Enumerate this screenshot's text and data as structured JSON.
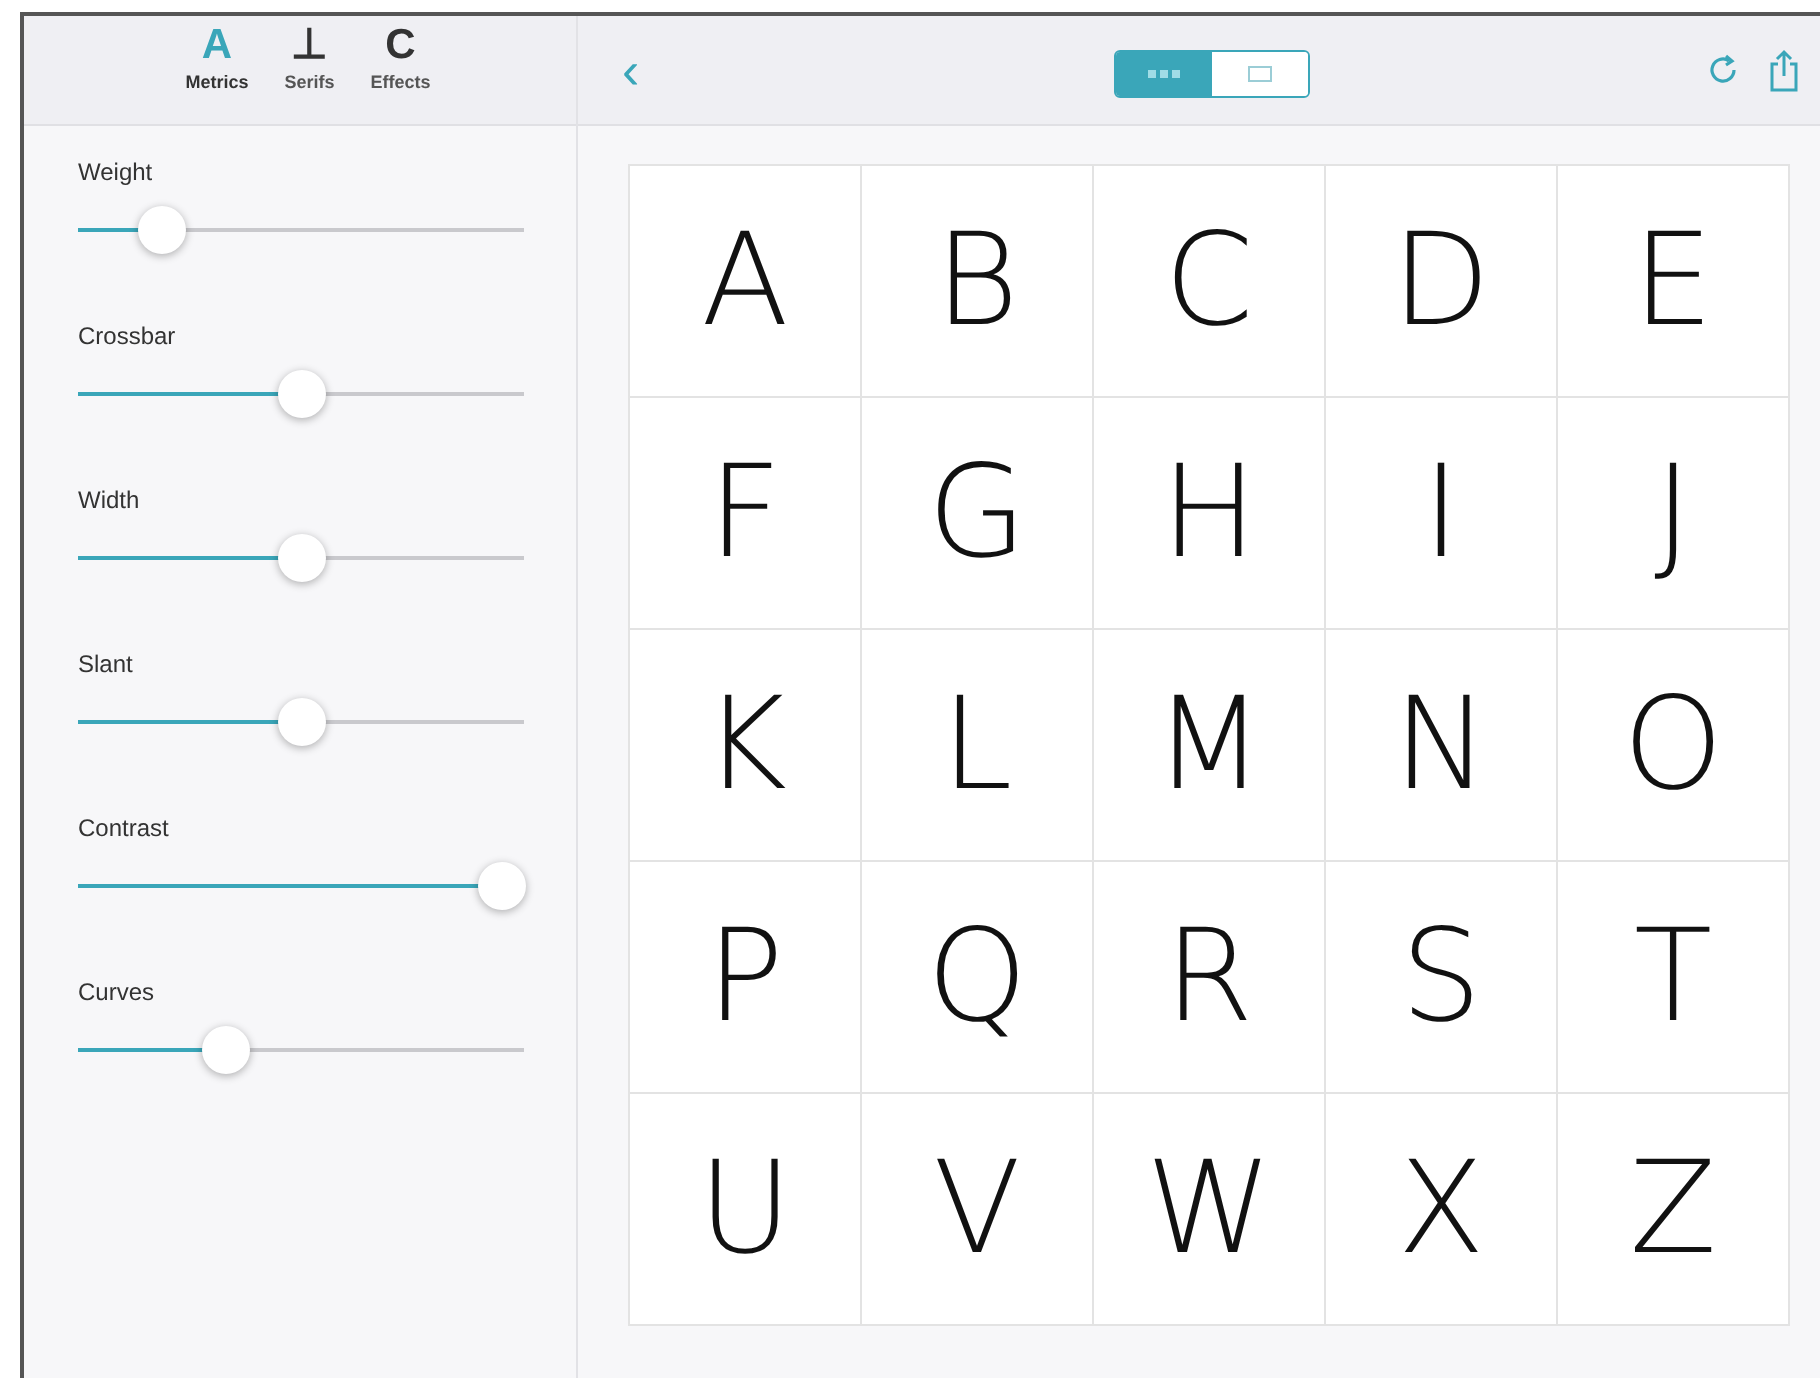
{
  "tabs": [
    {
      "glyph": "A",
      "label": "Metrics",
      "selected": true
    },
    {
      "glyph": "⊥",
      "label": "Serifs",
      "selected": false
    },
    {
      "glyph": "C",
      "label": "Effects",
      "selected": false
    }
  ],
  "sliders": [
    {
      "label": "Weight",
      "level": 0.19
    },
    {
      "label": "Crossbar",
      "level": 0.5
    },
    {
      "label": "Width",
      "level": 0.5
    },
    {
      "label": "Slant",
      "level": 0.5
    },
    {
      "label": "Contrast",
      "level": 0.95
    },
    {
      "label": "Curves",
      "level": 0.33
    }
  ],
  "toolbar": {
    "back": "‹",
    "view_modes": [
      {
        "kind": "grid",
        "selected": true
      },
      {
        "kind": "text",
        "selected": false
      }
    ]
  },
  "letters": [
    "A",
    "B",
    "C",
    "D",
    "E",
    "F",
    "G",
    "H",
    "I",
    "J",
    "K",
    "L",
    "M",
    "N",
    "O",
    "P",
    "Q",
    "R",
    "S",
    "T",
    "U",
    "V",
    "W",
    "X",
    "Z"
  ]
}
